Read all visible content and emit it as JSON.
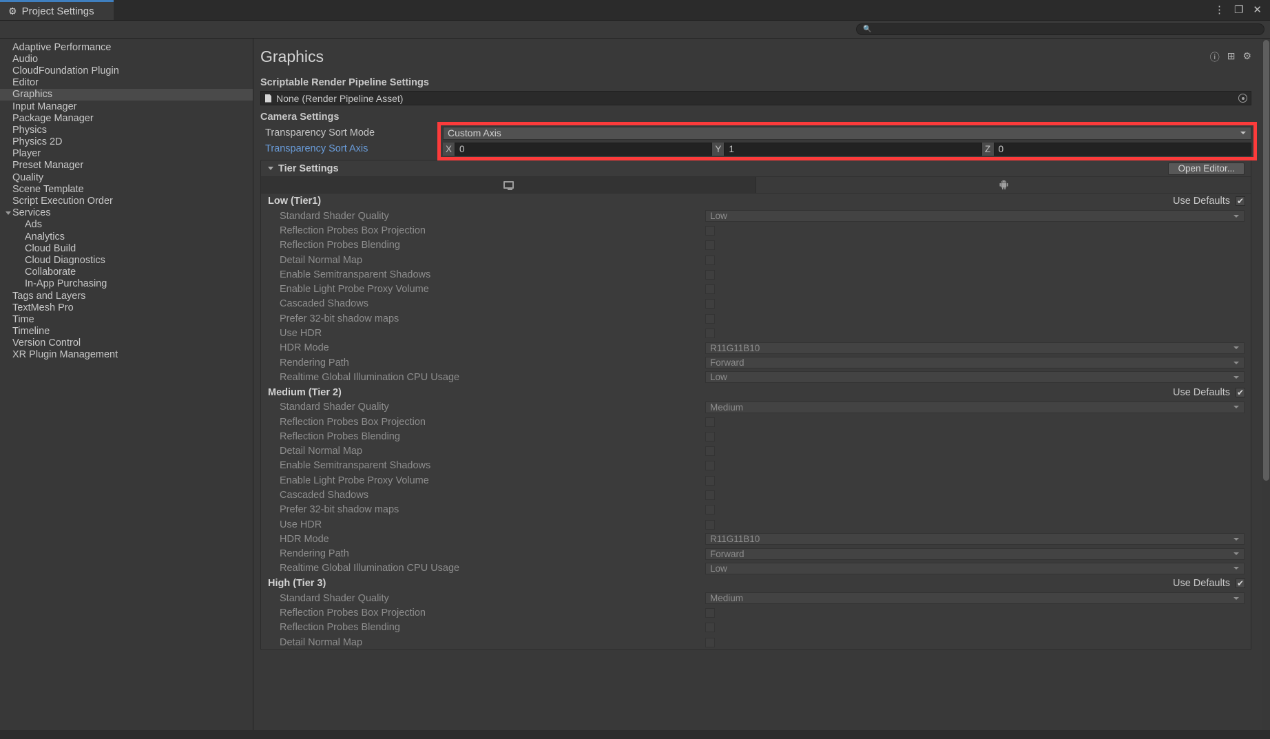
{
  "window": {
    "tab_title": "Project Settings",
    "gear_icon": "gear-icon",
    "menu_icon": "⋮",
    "maximize_icon": "❐",
    "close_icon": "✕"
  },
  "search": {
    "placeholder": "",
    "value": "",
    "icon": "search-icon"
  },
  "sidebar": {
    "items": [
      {
        "label": "Adaptive Performance",
        "selected": false,
        "child": false
      },
      {
        "label": "Audio",
        "selected": false,
        "child": false
      },
      {
        "label": "CloudFoundation Plugin",
        "selected": false,
        "child": false
      },
      {
        "label": "Editor",
        "selected": false,
        "child": false
      },
      {
        "label": "Graphics",
        "selected": true,
        "child": false
      },
      {
        "label": "Input Manager",
        "selected": false,
        "child": false
      },
      {
        "label": "Package Manager",
        "selected": false,
        "child": false
      },
      {
        "label": "Physics",
        "selected": false,
        "child": false
      },
      {
        "label": "Physics 2D",
        "selected": false,
        "child": false
      },
      {
        "label": "Player",
        "selected": false,
        "child": false
      },
      {
        "label": "Preset Manager",
        "selected": false,
        "child": false
      },
      {
        "label": "Quality",
        "selected": false,
        "child": false
      },
      {
        "label": "Scene Template",
        "selected": false,
        "child": false
      },
      {
        "label": "Script Execution Order",
        "selected": false,
        "child": false
      },
      {
        "label": "Services",
        "selected": false,
        "child": false,
        "expanded": true
      },
      {
        "label": "Ads",
        "selected": false,
        "child": true
      },
      {
        "label": "Analytics",
        "selected": false,
        "child": true
      },
      {
        "label": "Cloud Build",
        "selected": false,
        "child": true
      },
      {
        "label": "Cloud Diagnostics",
        "selected": false,
        "child": true
      },
      {
        "label": "Collaborate",
        "selected": false,
        "child": true
      },
      {
        "label": "In-App Purchasing",
        "selected": false,
        "child": true
      },
      {
        "label": "Tags and Layers",
        "selected": false,
        "child": false
      },
      {
        "label": "TextMesh Pro",
        "selected": false,
        "child": false
      },
      {
        "label": "Time",
        "selected": false,
        "child": false
      },
      {
        "label": "Timeline",
        "selected": false,
        "child": false
      },
      {
        "label": "Version Control",
        "selected": false,
        "child": false
      },
      {
        "label": "XR Plugin Management",
        "selected": false,
        "child": false
      }
    ]
  },
  "page": {
    "title": "Graphics",
    "help_icon": "help-icon",
    "preset_icon": "preset-icon",
    "settings_icon": "gear-icon"
  },
  "srp": {
    "section_label": "Scriptable Render Pipeline Settings",
    "asset_value": "None (Render Pipeline Asset)",
    "asset_icon": "document-icon",
    "picker_icon": "object-picker-icon"
  },
  "camera": {
    "section_label": "Camera Settings",
    "sort_mode_label": "Transparency Sort Mode",
    "sort_mode_value": "Custom Axis",
    "sort_axis_label": "Transparency Sort Axis",
    "axis": {
      "x_label": "X",
      "x_value": "0",
      "y_label": "Y",
      "y_value": "1",
      "z_label": "Z",
      "z_value": "0"
    },
    "highlight_color": "#fc3b3b"
  },
  "tier": {
    "header": "Tier Settings",
    "open_editor": "Open Editor...",
    "platform_tabs": [
      {
        "icon": "monitor-icon",
        "active": true
      },
      {
        "icon": "android-icon",
        "active": false
      }
    ],
    "use_defaults_label": "Use Defaults",
    "checkbox_glyph": "✔",
    "groups": [
      {
        "title": "Low (Tier1)",
        "use_defaults": true,
        "rows": [
          {
            "label": "Standard Shader Quality",
            "type": "dropdown",
            "value": "Low"
          },
          {
            "label": "Reflection Probes Box Projection",
            "type": "checkbox",
            "value": false
          },
          {
            "label": "Reflection Probes Blending",
            "type": "checkbox",
            "value": false
          },
          {
            "label": "Detail Normal Map",
            "type": "checkbox",
            "value": false
          },
          {
            "label": "Enable Semitransparent Shadows",
            "type": "checkbox",
            "value": false
          },
          {
            "label": "Enable Light Probe Proxy Volume",
            "type": "checkbox",
            "value": false
          },
          {
            "label": "Cascaded Shadows",
            "type": "checkbox",
            "value": false
          },
          {
            "label": "Prefer 32-bit shadow maps",
            "type": "checkbox",
            "value": false
          },
          {
            "label": "Use HDR",
            "type": "checkbox",
            "value": false
          },
          {
            "label": "HDR Mode",
            "type": "dropdown",
            "value": "R11G11B10"
          },
          {
            "label": "Rendering Path",
            "type": "dropdown",
            "value": "Forward"
          },
          {
            "label": "Realtime Global Illumination CPU Usage",
            "type": "dropdown",
            "value": "Low"
          }
        ]
      },
      {
        "title": "Medium (Tier 2)",
        "use_defaults": true,
        "rows": [
          {
            "label": "Standard Shader Quality",
            "type": "dropdown",
            "value": "Medium"
          },
          {
            "label": "Reflection Probes Box Projection",
            "type": "checkbox",
            "value": false
          },
          {
            "label": "Reflection Probes Blending",
            "type": "checkbox",
            "value": false
          },
          {
            "label": "Detail Normal Map",
            "type": "checkbox",
            "value": false
          },
          {
            "label": "Enable Semitransparent Shadows",
            "type": "checkbox",
            "value": false
          },
          {
            "label": "Enable Light Probe Proxy Volume",
            "type": "checkbox",
            "value": false
          },
          {
            "label": "Cascaded Shadows",
            "type": "checkbox",
            "value": false
          },
          {
            "label": "Prefer 32-bit shadow maps",
            "type": "checkbox",
            "value": false
          },
          {
            "label": "Use HDR",
            "type": "checkbox",
            "value": false
          },
          {
            "label": "HDR Mode",
            "type": "dropdown",
            "value": "R11G11B10"
          },
          {
            "label": "Rendering Path",
            "type": "dropdown",
            "value": "Forward"
          },
          {
            "label": "Realtime Global Illumination CPU Usage",
            "type": "dropdown",
            "value": "Low"
          }
        ]
      },
      {
        "title": "High (Tier 3)",
        "use_defaults": true,
        "rows": [
          {
            "label": "Standard Shader Quality",
            "type": "dropdown",
            "value": "Medium"
          },
          {
            "label": "Reflection Probes Box Projection",
            "type": "checkbox",
            "value": false
          },
          {
            "label": "Reflection Probes Blending",
            "type": "checkbox",
            "value": false
          },
          {
            "label": "Detail Normal Map",
            "type": "checkbox",
            "value": false
          }
        ]
      }
    ]
  }
}
